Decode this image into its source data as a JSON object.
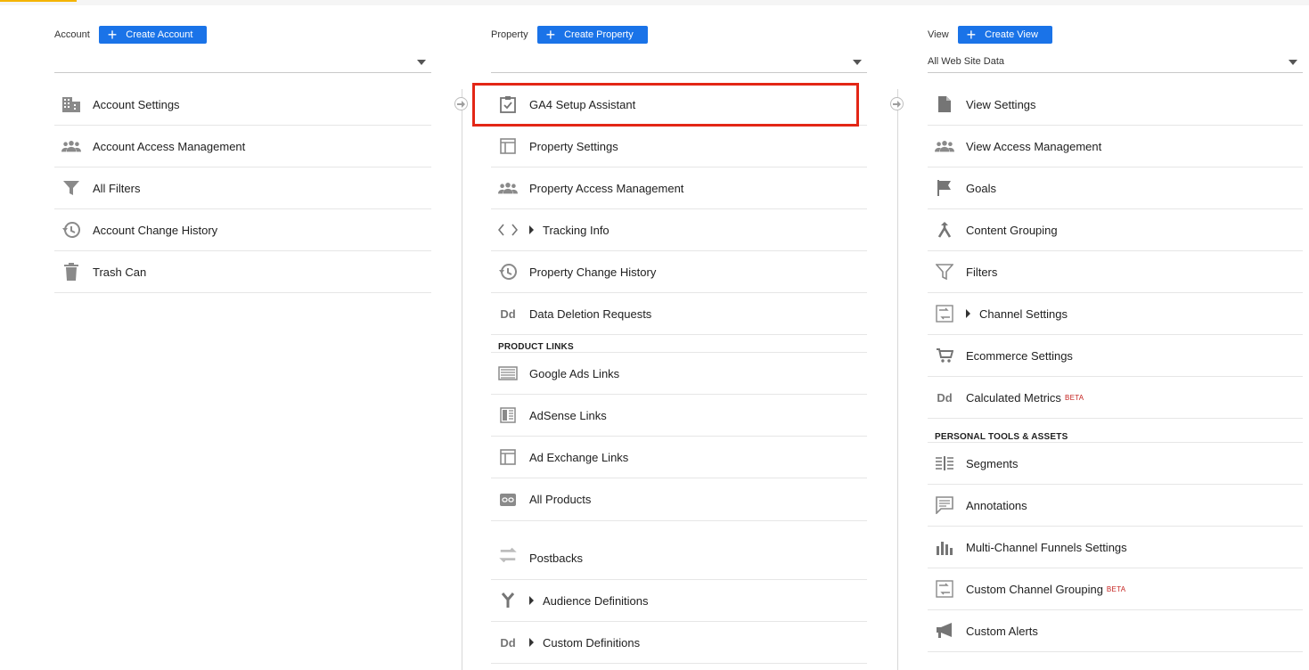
{
  "account": {
    "label": "Account",
    "create_label": "Create Account",
    "selector_value": "",
    "items": [
      {
        "label": "Account Settings",
        "icon": "building-icon"
      },
      {
        "label": "Account Access Management",
        "icon": "people-icon"
      },
      {
        "label": "All Filters",
        "icon": "filter-icon"
      },
      {
        "label": "Account Change History",
        "icon": "history-icon"
      },
      {
        "label": "Trash Can",
        "icon": "trash-icon"
      }
    ]
  },
  "property": {
    "label": "Property",
    "create_label": "Create Property",
    "selector_value": "",
    "items": [
      {
        "label": "GA4 Setup Assistant",
        "icon": "clipboard-check-icon"
      },
      {
        "label": "Property Settings",
        "icon": "layout-icon"
      },
      {
        "label": "Property Access Management",
        "icon": "people-icon"
      },
      {
        "label": "Tracking Info",
        "icon": "code-icon"
      },
      {
        "label": "Property Change History",
        "icon": "history-icon"
      },
      {
        "label": "Data Deletion Requests",
        "icon": "dd-icon",
        "icon_text": "Dd"
      }
    ],
    "links_title": "PRODUCT LINKS",
    "links": [
      {
        "label": "Google Ads Links",
        "icon": "ads-icon"
      },
      {
        "label": "AdSense Links",
        "icon": "adsense-icon"
      },
      {
        "label": "Ad Exchange Links",
        "icon": "adexchange-icon"
      },
      {
        "label": "All Products",
        "icon": "link-icon"
      },
      {
        "label": "Postbacks",
        "icon": "swap-icon"
      },
      {
        "label": "Audience Definitions",
        "icon": "fork-icon"
      },
      {
        "label": "Custom Definitions",
        "icon": "dd-icon",
        "icon_text": "Dd"
      }
    ]
  },
  "view": {
    "label": "View",
    "create_label": "Create View",
    "selector_value": "All Web Site Data",
    "items": [
      {
        "label": "View Settings",
        "icon": "document-icon"
      },
      {
        "label": "View Access Management",
        "icon": "people-icon"
      },
      {
        "label": "Goals",
        "icon": "flag-icon"
      },
      {
        "label": "Content Grouping",
        "icon": "merge-icon"
      },
      {
        "label": "Filters",
        "icon": "filter-icon"
      },
      {
        "label": "Channel Settings",
        "icon": "channel-icon"
      },
      {
        "label": "Ecommerce Settings",
        "icon": "cart-icon"
      },
      {
        "label": "Calculated Metrics",
        "icon": "dd-icon",
        "icon_text": "Dd",
        "badge": "BETA"
      }
    ],
    "tools_title": "PERSONAL TOOLS & ASSETS",
    "tools": [
      {
        "label": "Segments",
        "icon": "segments-icon"
      },
      {
        "label": "Annotations",
        "icon": "comment-icon"
      },
      {
        "label": "Multi-Channel Funnels Settings",
        "icon": "bars-icon"
      },
      {
        "label": "Custom Channel Grouping",
        "icon": "channel-icon",
        "badge": "BETA"
      },
      {
        "label": "Custom Alerts",
        "icon": "megaphone-icon"
      }
    ]
  },
  "colors": {
    "create_button": "#1a73e8",
    "highlight_box": "#e32616",
    "beta_badge": "#c5221f"
  }
}
